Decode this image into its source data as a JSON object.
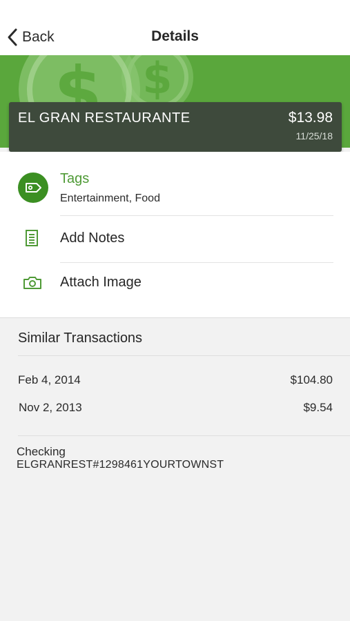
{
  "nav": {
    "back_label": "Back",
    "title": "Details"
  },
  "banner": {
    "background_color": "#5aa73c",
    "decoration": "dollar-coins"
  },
  "transaction": {
    "merchant": "EL GRAN RESTAURANTE",
    "amount": "$13.98",
    "date": "11/25/18"
  },
  "details": {
    "tags_label": "Tags",
    "tags_value": "Entertainment, Food",
    "tags_icon": "tag-icon",
    "notes_label": "Add Notes",
    "notes_icon": "notes-icon",
    "image_label": "Attach Image",
    "image_icon": "camera-icon"
  },
  "similar": {
    "title": "Similar Transactions",
    "items": [
      {
        "date": "Feb 4, 2014",
        "amount": "$104.80"
      },
      {
        "date": "Nov 2, 2013",
        "amount": "$9.54"
      }
    ]
  },
  "account": {
    "type": "Checking",
    "description": "ELGRANREST#1298461YOURTOWNST"
  },
  "colors": {
    "accent_green": "#4f9a36",
    "tag_circle": "#3b8f22",
    "card_dark": "#3e4a3c"
  }
}
